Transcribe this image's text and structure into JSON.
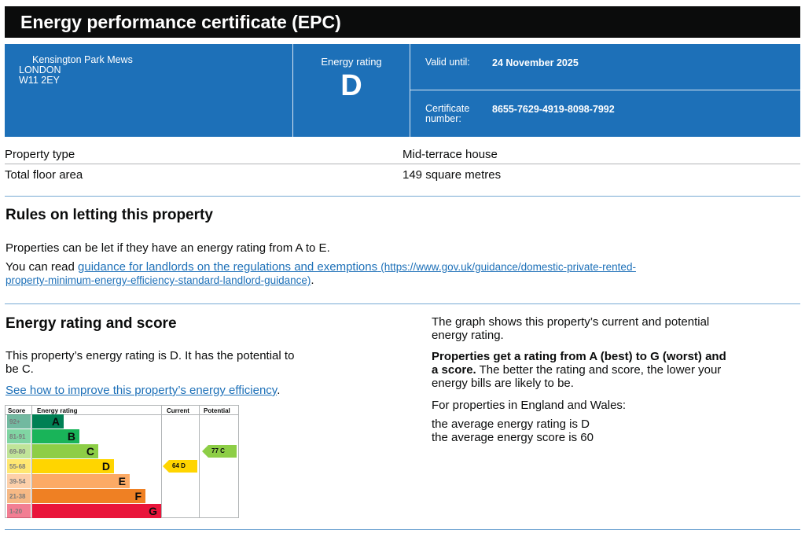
{
  "header": {
    "title": "Energy performance certificate (EPC)"
  },
  "address": {
    "line1": "Kensington Park Mews",
    "line2": "LONDON",
    "line3": "W11 2EY"
  },
  "rating": {
    "label": "Energy rating",
    "letter": "D"
  },
  "valid": {
    "label": "Valid until:",
    "value": "24 November 2025"
  },
  "certificate": {
    "label": "Certificate number:",
    "value": "8655-7629-4919-8098-7992"
  },
  "property": [
    {
      "label": "Property type",
      "value": "Mid-terrace house"
    },
    {
      "label": "Total floor area",
      "value": "149 square metres"
    }
  ],
  "rules": {
    "heading": "Rules on letting this property",
    "text1": "Properties can be let if they have an energy rating from A to E.",
    "text2_prefix": "You can read ",
    "link_text": "guidance for landlords on the regulations and exemptions",
    "link_url_a": "(https://www.gov.uk/guidance/domestic-private-rented-",
    "link_url_b": "property-minimum-energy-efficiency-standard-landlord-guidance)",
    "text2_suffix": "."
  },
  "energy": {
    "heading": "Energy rating and score",
    "text_a": "This property’s energy rating is D. It has the potential to",
    "text_b": "be C.",
    "improve_link": "See how to improve this property’s energy efficiency",
    "improve_suffix": ".",
    "graph_a": "The graph shows this property’s current and potential",
    "graph_b": "energy rating.",
    "bold_a": "Properties get a rating from A (best) to G (worst) and",
    "bold_b": "a score.",
    "rest_a": " The better the rating and score, the lower your",
    "rest_b": "energy bills are likely to be.",
    "eng_wales": "For properties in England and Wales:",
    "avg_rating": "the average energy rating is D",
    "avg_score": "the average energy score is 60"
  },
  "chart_data": {
    "type": "table",
    "headers": {
      "score": "Score",
      "rating": "Energy rating",
      "current": "Current",
      "potential": "Potential"
    },
    "bands": [
      {
        "range": "92+",
        "letter": "A",
        "color": "#008054"
      },
      {
        "range": "81-91",
        "letter": "B",
        "color": "#19b459"
      },
      {
        "range": "69-80",
        "letter": "C",
        "color": "#8dce46"
      },
      {
        "range": "55-68",
        "letter": "D",
        "color": "#ffd500"
      },
      {
        "range": "39-54",
        "letter": "E",
        "color": "#fcaa65"
      },
      {
        "range": "21-38",
        "letter": "F",
        "color": "#ef8023"
      },
      {
        "range": "1-20",
        "letter": "G",
        "color": "#e9153b"
      }
    ],
    "current": {
      "score": 64,
      "letter": "D",
      "label": "64  D",
      "color": "#ffd500"
    },
    "potential": {
      "score": 77,
      "letter": "C",
      "label": "77  C",
      "color": "#8dce46"
    }
  }
}
